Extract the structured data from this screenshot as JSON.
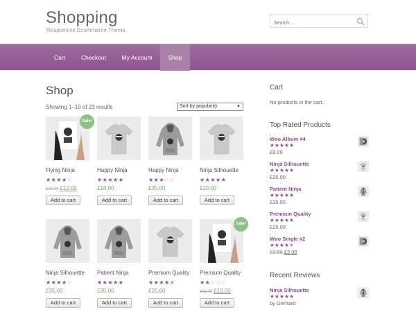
{
  "site": {
    "title": "Shopping",
    "description": "Responsive Ecommerce Theme"
  },
  "search": {
    "placeholder": "Search ...",
    "icon": "search-icon"
  },
  "nav": {
    "items": [
      {
        "label": "Cart"
      },
      {
        "label": "Checkout"
      },
      {
        "label": "My Account"
      },
      {
        "label": "Shop",
        "active": true
      }
    ]
  },
  "shop": {
    "title": "Shop",
    "result_count": "Showing 1–10 of 23 results",
    "orderby": "Sort by popularity"
  },
  "products": [
    {
      "name": "Flying Ninja",
      "rating": 4,
      "old_price": "£15.00",
      "price": "£12.00",
      "sale": "Sale!",
      "button": "Add to cart",
      "image": "poster-icon"
    },
    {
      "name": "Happy Ninja",
      "rating": 5,
      "old_price": "",
      "price": "£18.00",
      "sale": "",
      "button": "Add to cart",
      "image": "tshirt-icon"
    },
    {
      "name": "Happy Ninja",
      "rating": 3,
      "old_price": "",
      "price": "£35.00",
      "sale": "",
      "button": "Add to cart",
      "image": "hoodie-icon"
    },
    {
      "name": "Ninja Silhouette",
      "rating": 5,
      "old_price": "",
      "price": "£20.00",
      "sale": "",
      "button": "Add to cart",
      "image": "tshirt-icon"
    },
    {
      "name": "Ninja Silhouette",
      "rating": 4,
      "old_price": "",
      "price": "£35.00",
      "sale": "",
      "button": "Add to cart",
      "image": "hoodie-icon"
    },
    {
      "name": "Patient Ninja",
      "rating": 5,
      "old_price": "",
      "price": "£35.00",
      "sale": "",
      "button": "Add to cart",
      "image": "hoodie-icon"
    },
    {
      "name": "Premium Quality",
      "rating": 4.5,
      "old_price": "",
      "price": "£20.00",
      "sale": "",
      "button": "Add to cart",
      "image": "tshirt-icon"
    },
    {
      "name": "Premium Quality",
      "rating": 2,
      "old_price": "£15.00",
      "price": "£12.00",
      "sale": "Sale!",
      "button": "Add to cart",
      "image": "poster-icon"
    }
  ],
  "sidebar": {
    "cart_title": "Cart",
    "cart_empty": "No products in the cart.",
    "top_rated_title": "Top Rated Products",
    "top_rated": [
      {
        "name": "Woo Album #4",
        "rating": 5,
        "old_price": "",
        "price": "£9.00",
        "image": "album-icon"
      },
      {
        "name": "Ninja Silhouette",
        "rating": 5,
        "old_price": "",
        "price": "£20.00",
        "image": "tshirt-icon"
      },
      {
        "name": "Patient Ninja",
        "rating": 5,
        "old_price": "",
        "price": "£35.00",
        "image": "hoodie-icon"
      },
      {
        "name": "Premium Quality",
        "rating": 5,
        "old_price": "",
        "price": "£20.00",
        "image": "tshirt-icon"
      },
      {
        "name": "Woo Single #2",
        "rating": 4.5,
        "old_price": "£3.00",
        "price": "£2.00",
        "image": "album-icon"
      }
    ],
    "reviews_title": "Recent Reviews",
    "reviews": [
      {
        "name": "Ninja Silhouette",
        "rating": 5,
        "author": "by Gerhard",
        "image": "hoodie-icon"
      }
    ]
  },
  "colors": {
    "accent": "#8b4f8b",
    "nav_bg": "#955e95",
    "nav_active": "#a981a9",
    "price": "#7aa76f",
    "sale_badge": "#8fbf8a"
  }
}
